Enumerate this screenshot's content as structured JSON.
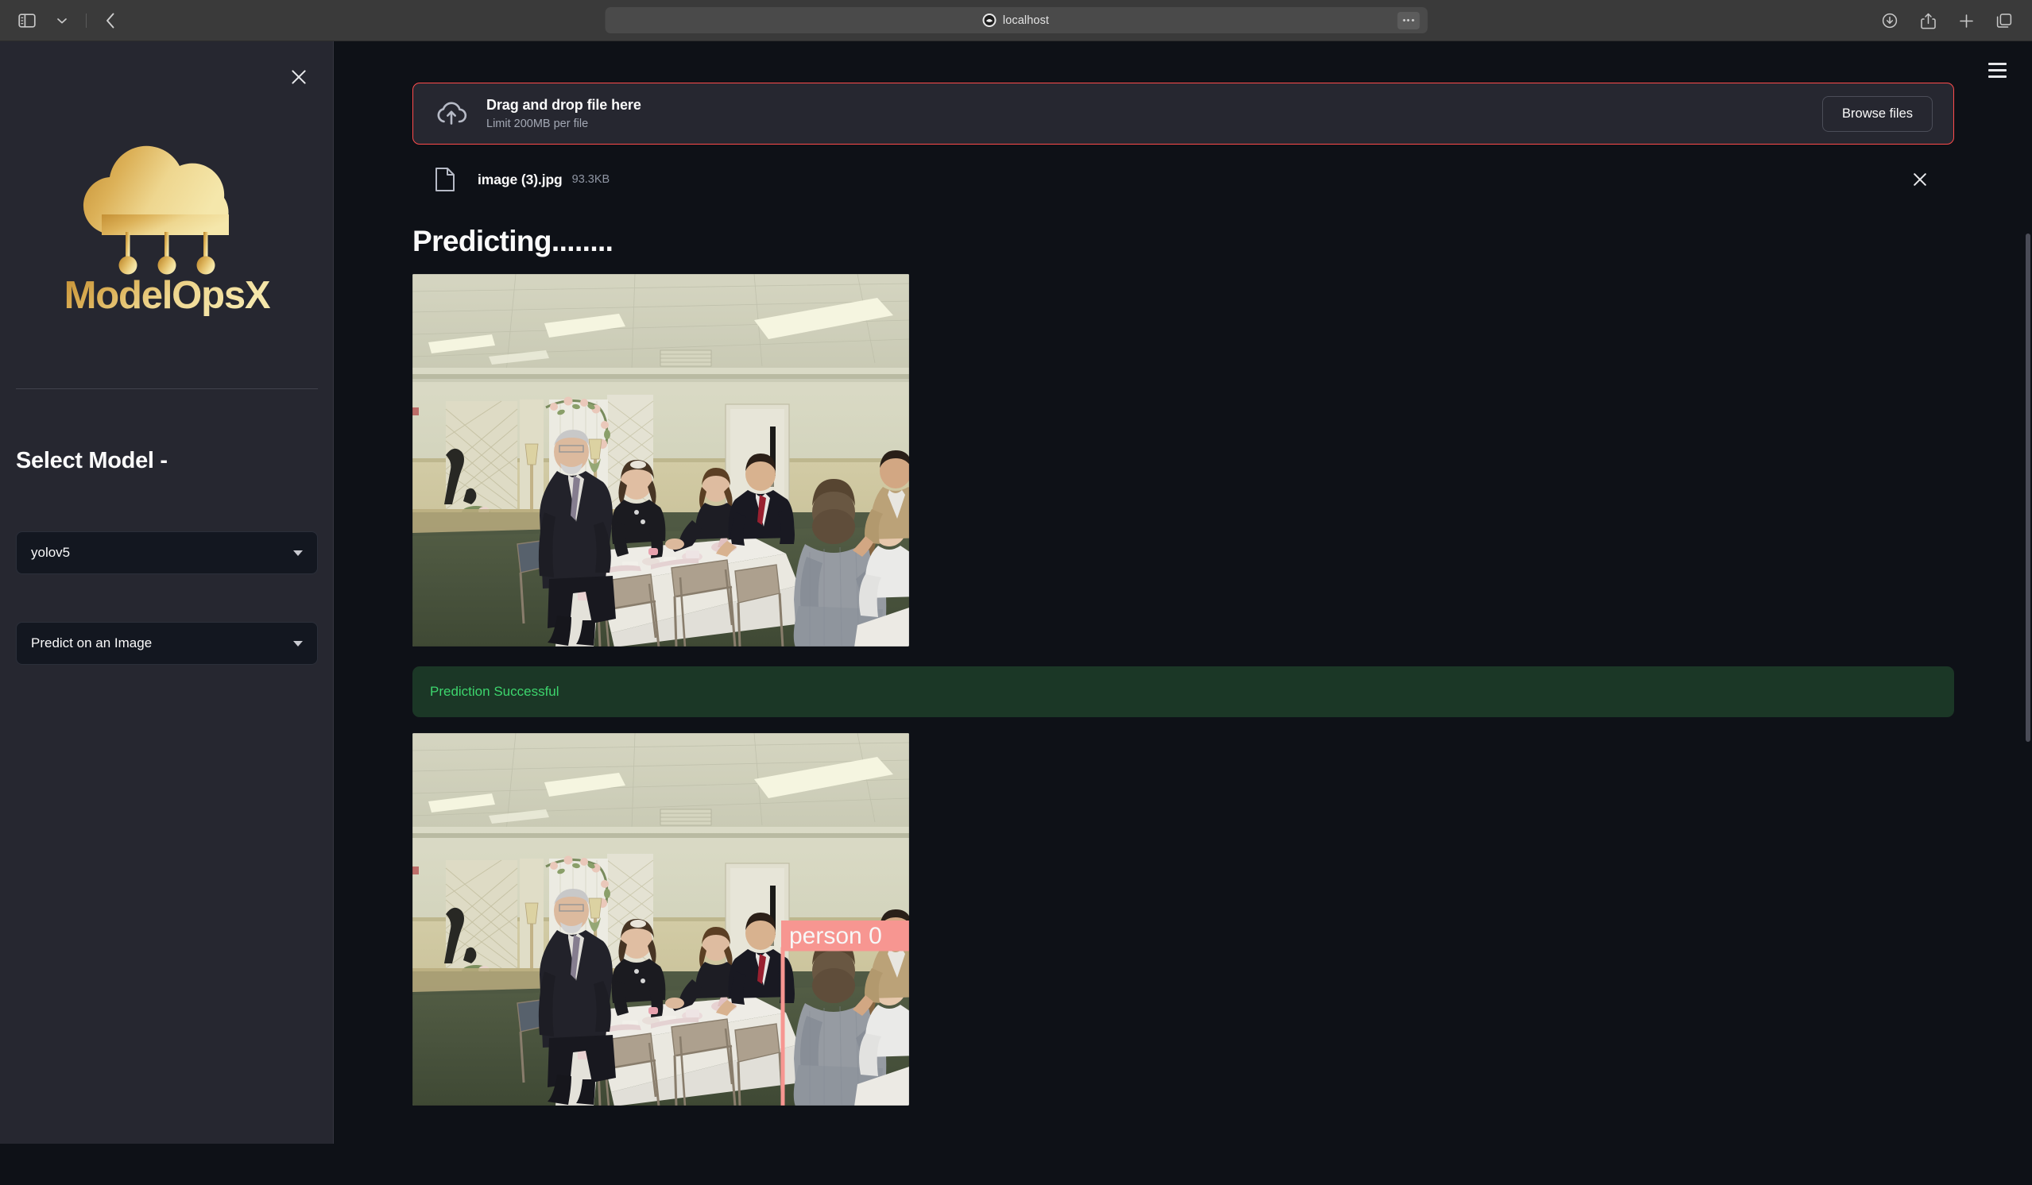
{
  "browser": {
    "url": "localhost",
    "sidebar_toggle_icon": "sidebar-toggle-icon",
    "tab_group_chevron_icon": "chevron-down-icon",
    "back_icon": "chevron-left-icon",
    "favicon_icon": "site-favicon",
    "more_icon": "ellipsis-icon",
    "downloads_icon": "download-icon",
    "share_icon": "share-icon",
    "new_tab_icon": "plus-icon",
    "tabs_overview_icon": "tabs-overview-icon"
  },
  "sidebar": {
    "close_icon": "close-icon",
    "logo_text": "ModelOpsX",
    "logo_icon": "cloud-nodes-logo",
    "heading": "Select Model -",
    "model_select": {
      "value": "yolov5",
      "caret_icon": "chevron-down-icon"
    },
    "task_select": {
      "value": "Predict on an Image",
      "caret_icon": "chevron-down-icon"
    }
  },
  "main": {
    "menu_icon": "hamburger-menu-icon",
    "uploader": {
      "icon": "cloud-upload-icon",
      "title": "Drag and drop file here",
      "subtitle": "Limit 200MB per file",
      "browse_label": "Browse files",
      "border_color": "#ff4b4b"
    },
    "uploaded_file": {
      "icon": "file-document-icon",
      "name": "image (3).jpg",
      "size": "93.3KB",
      "remove_icon": "close-icon"
    },
    "status_heading": "Predicting........",
    "expand_icon": "fullscreen-expand-icon",
    "alert": {
      "text": "Prediction Successful",
      "text_color": "#3dd56d",
      "background_color": "#1b3726"
    },
    "detection": {
      "label": "person 0",
      "box_color": "#ff9b96",
      "label_text_color": "#ffffff"
    }
  },
  "theme": {
    "app_background": "#0e1117",
    "sidebar_background": "#262730",
    "text_primary": "#fafafa",
    "accent_red": "#ff4b4b",
    "logo_gold_light": "#f0dc96",
    "logo_gold_dark": "#c79b3e"
  }
}
